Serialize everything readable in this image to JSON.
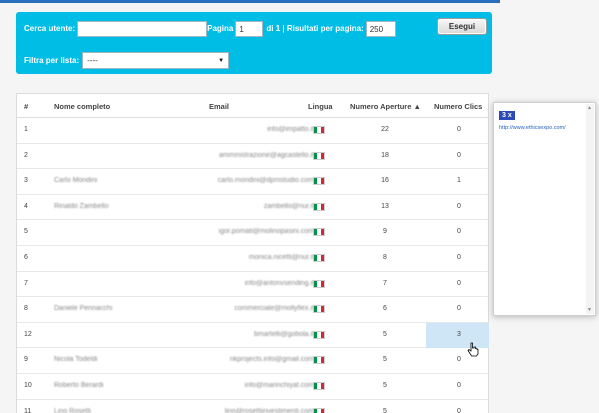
{
  "filter": {
    "search_label": "Cerca utente:",
    "search_value": "",
    "page_label": "Pagina",
    "page_value": "1",
    "of_pages": "di 1 | Risultati per pagina:",
    "per_page_value": "250",
    "run_button": "Esegui",
    "list_label": "Filtra per lista:",
    "list_value": "----"
  },
  "table": {
    "headers": [
      "#",
      "Nome completo",
      "Email",
      "Lingua",
      "Numero Aperture ▲",
      "Numero Clics"
    ],
    "rows": [
      {
        "idx": "1",
        "name": "",
        "email": "info@impatto.it",
        "opens": "22",
        "clicks": "0"
      },
      {
        "idx": "2",
        "name": "",
        "email": "amministrazione@agcastello.it",
        "opens": "18",
        "clicks": "0"
      },
      {
        "idx": "3",
        "name": "Carlo Mondini",
        "email": "carlo.mondini@dpmstudio.com",
        "opens": "16",
        "clicks": "1"
      },
      {
        "idx": "4",
        "name": "Rinaldo Zambello",
        "email": "zambello@nur.it",
        "opens": "13",
        "clicks": "0"
      },
      {
        "idx": "5",
        "name": "",
        "email": "igor.pomati@molinopasini.com",
        "opens": "9",
        "clicks": "0"
      },
      {
        "idx": "6",
        "name": "",
        "email": "monica.nicetti@nur.it",
        "opens": "8",
        "clicks": "0"
      },
      {
        "idx": "7",
        "name": "",
        "email": "info@antonvsending.it",
        "opens": "7",
        "clicks": "0"
      },
      {
        "idx": "8",
        "name": "Daniele Pennacchi",
        "email": "commerciale@mollyflex.it",
        "opens": "6",
        "clicks": "0"
      },
      {
        "idx": "12",
        "name": "",
        "email": "bmartelli@gobola.it",
        "opens": "5",
        "clicks": "3"
      },
      {
        "idx": "9",
        "name": "Nicola Todeldi",
        "email": "nkprojects.info@gmail.com",
        "opens": "5",
        "clicks": "0"
      },
      {
        "idx": "10",
        "name": "Roberto Berardi",
        "email": "info@marinchiyat.com",
        "opens": "5",
        "clicks": "0"
      },
      {
        "idx": "11",
        "name": "Lino Rosetti",
        "email": "lino@rosettiinvestimenti.com",
        "opens": "5",
        "clicks": "0"
      }
    ]
  },
  "popup": {
    "count_badge": "3 x",
    "link": "http://www.ethicsexpo.com/"
  },
  "colors": {
    "panel": "#00bde5",
    "highlight": "#cfe6f7",
    "badge": "#2c4bb8",
    "flag_green": "#009246",
    "flag_white": "#ffffff",
    "flag_red": "#ce2b37"
  }
}
